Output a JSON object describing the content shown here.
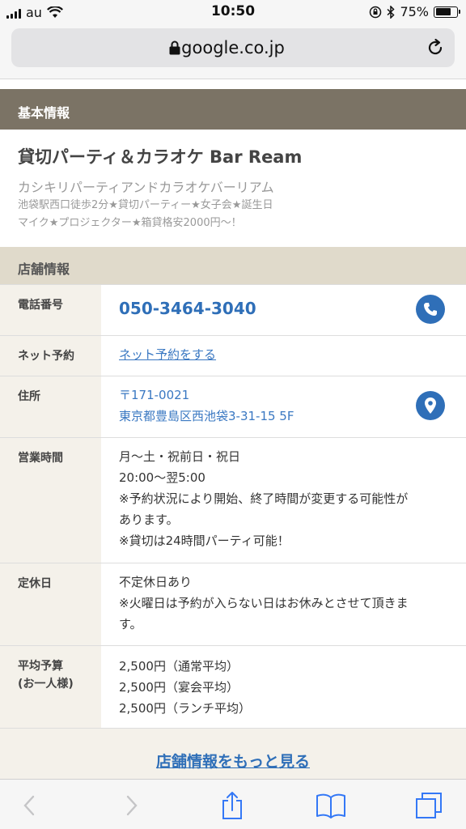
{
  "status_bar": {
    "carrier": "au",
    "time": "10:50",
    "battery_percent": "75%",
    "battery_level": 0.75
  },
  "browser": {
    "url": "google.co.jp"
  },
  "basic_info": {
    "header": "基本情報",
    "store_name": "貸切パーティ＆カラオケ Bar Ream",
    "store_kana": "カシキリパーティアンドカラオケバーリアム",
    "catch_line1": "池袋駅西口徒歩2分★貸切パーティー★女子会★誕生日",
    "catch_line2": "マイク★プロジェクター★箱貸格安2000円〜！"
  },
  "store_info": {
    "header": "店舗情報",
    "phone": {
      "label": "電話番号",
      "value": "050-3464-3040"
    },
    "reservation": {
      "label": "ネット予約",
      "value": "ネット予約をする"
    },
    "address": {
      "label": "住所",
      "postal": "〒171-0021",
      "street": "東京都豊島区西池袋3-31-15 5F"
    },
    "hours": {
      "label": "営業時間",
      "line1": "月〜土・祝前日・祝日",
      "line2": "20:00〜翌5:00",
      "line3": "※予約状況により開始、終了時間が変更する可能性が",
      "line4": "あります。",
      "line5": "※貸切は24時間パーティ可能！"
    },
    "holiday": {
      "label": "定休日",
      "line1": "不定休日あり",
      "line2": "※火曜日は予約が入らない日はお休みとさせて頂きま",
      "line3": "す。"
    },
    "budget": {
      "label_line1": "平均予算",
      "label_line2": "(お一人様)",
      "line1": "2,500円（通常平均）",
      "line2": "2,500円（宴会平均）",
      "line3": "2,500円（ランチ平均）"
    },
    "more_link": "店舗情報をもっと見る"
  },
  "colors": {
    "accent_blue": "#2f6fb8",
    "header_dark": "#7b7365",
    "header_light": "#e0dacb"
  }
}
